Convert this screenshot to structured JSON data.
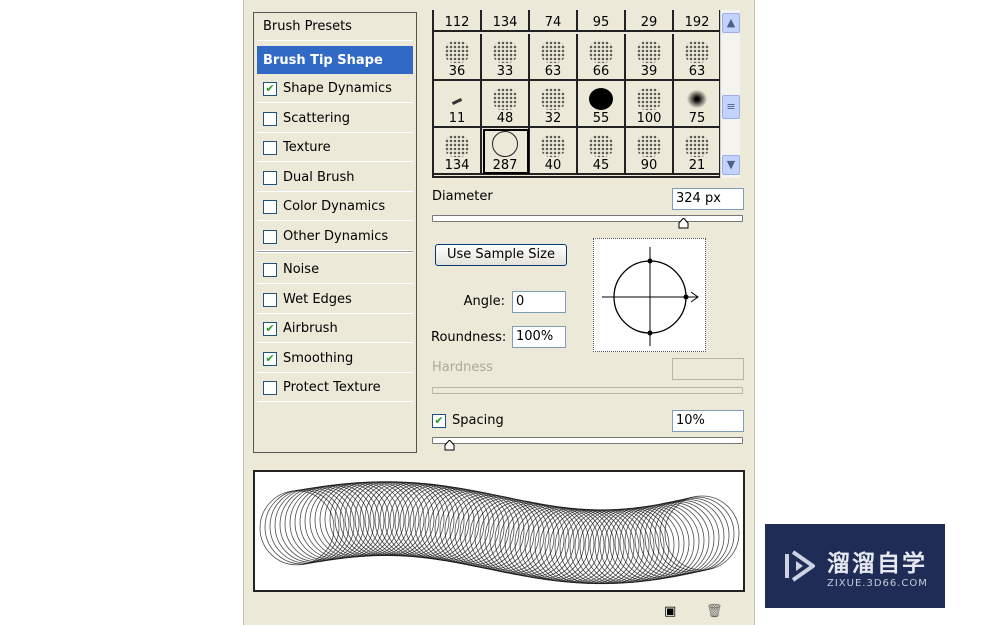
{
  "sidebar": {
    "items": [
      {
        "label": "Brush Presets",
        "checkbox": null
      },
      {
        "label": "Brush Tip Shape",
        "checkbox": null,
        "selected": true
      },
      {
        "label": "Shape Dynamics",
        "checkbox": true
      },
      {
        "label": "Scattering",
        "checkbox": false
      },
      {
        "label": "Texture",
        "checkbox": false
      },
      {
        "label": "Dual Brush",
        "checkbox": false
      },
      {
        "label": "Color Dynamics",
        "checkbox": false
      },
      {
        "label": "Other Dynamics",
        "checkbox": false
      },
      {
        "label": "Noise",
        "checkbox": false
      },
      {
        "label": "Wet Edges",
        "checkbox": false
      },
      {
        "label": "Airbrush",
        "checkbox": true
      },
      {
        "label": "Smoothing",
        "checkbox": true
      },
      {
        "label": "Protect Texture",
        "checkbox": false
      }
    ]
  },
  "brushes": [
    "112",
    "134",
    "74",
    "95",
    "29",
    "192",
    "36",
    "33",
    "63",
    "66",
    "39",
    "63",
    "11",
    "48",
    "32",
    "55",
    "100",
    "75",
    "134",
    "287",
    "40",
    "45",
    "90",
    "21"
  ],
  "selected_brush": "287",
  "diameter": {
    "label": "Diameter",
    "value": "324 px",
    "slider_fraction": 0.82
  },
  "use_sample_size": "Use Sample Size",
  "angle": {
    "label": "Angle:",
    "value": "0"
  },
  "roundness": {
    "label": "Roundness:",
    "value": "100%"
  },
  "hardness": {
    "label": "Hardness",
    "value": ""
  },
  "spacing": {
    "label": "Spacing",
    "checked": true,
    "value": "10%",
    "slider_fraction": 0.04
  },
  "watermark": {
    "title": "溜溜自学",
    "url": "ZIXUE.3D66.COM",
    "bg": "#1f2d56"
  },
  "colors": {
    "selected": "#316ac5",
    "panel": "#ece9d8"
  }
}
